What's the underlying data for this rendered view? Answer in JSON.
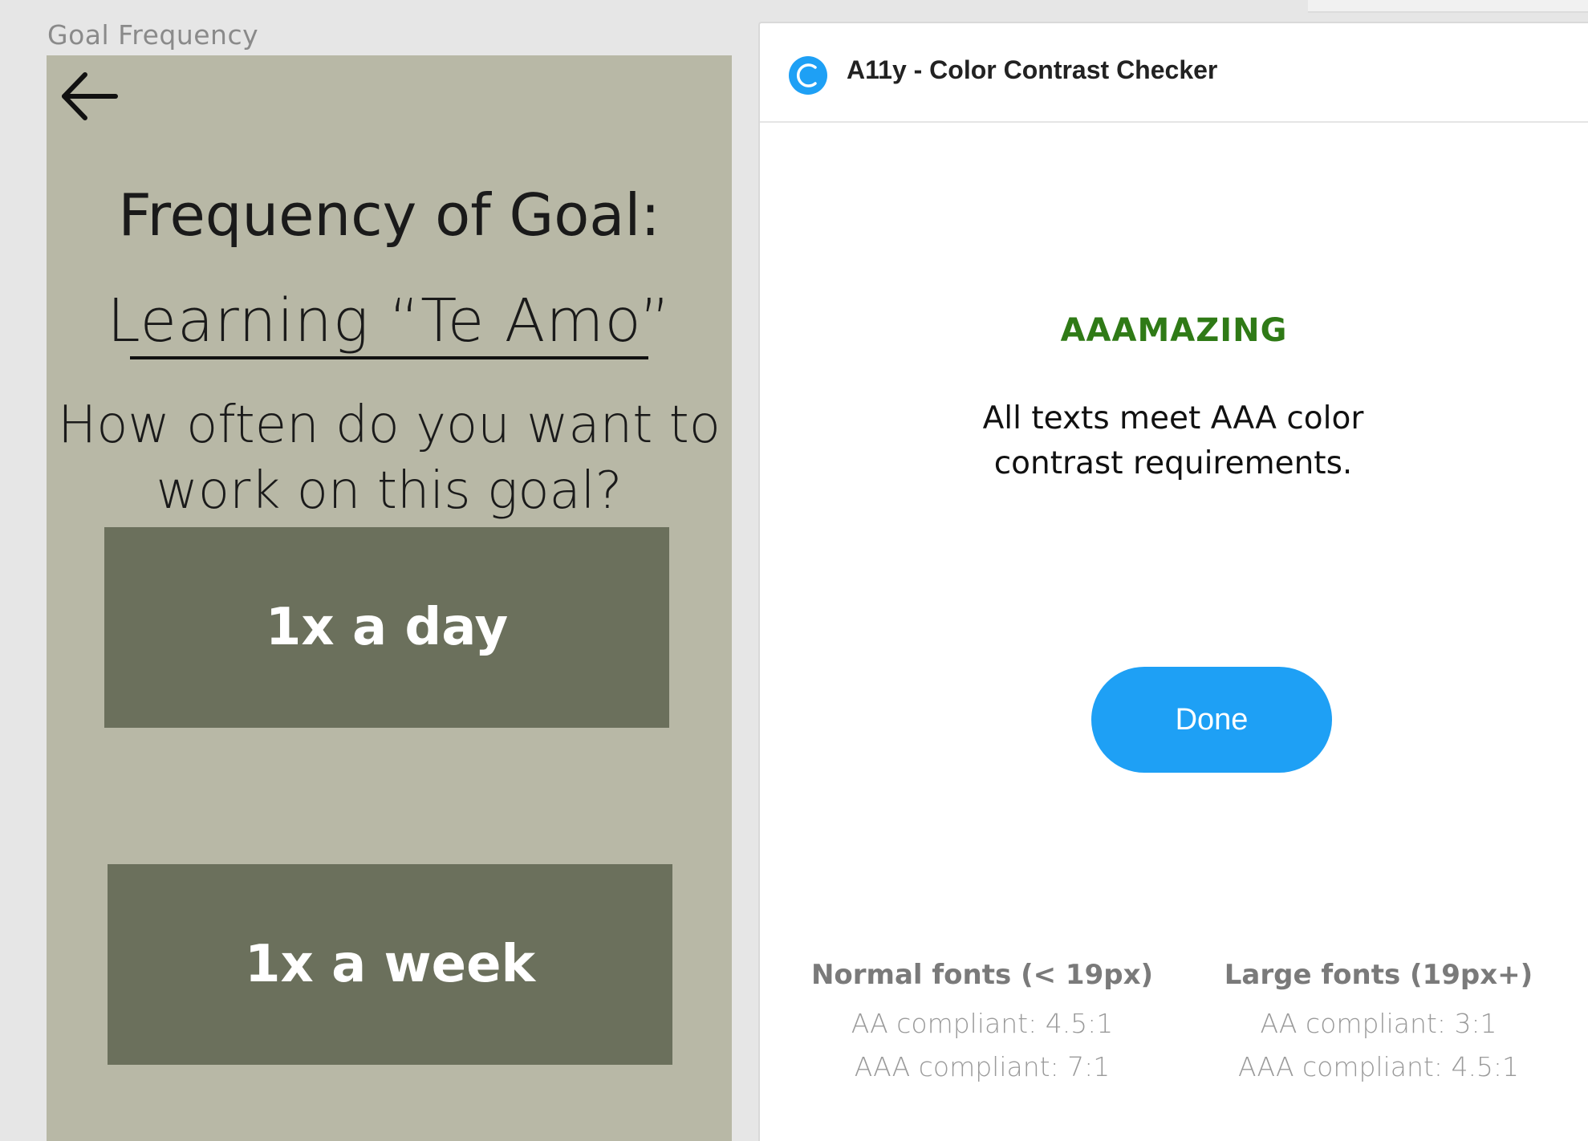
{
  "canvas": {
    "frame_label": "Goal Frequency"
  },
  "phone": {
    "title": "Frequency of Goal:",
    "goal_name": "Learning “Te Amo”",
    "question": "How often do you want to work on this goal?",
    "options": [
      {
        "label": "1x a day"
      },
      {
        "label": "1x a week"
      }
    ],
    "colors": {
      "background": "#b8b8a6",
      "button": "#6b705c",
      "button_text": "#ffffff"
    }
  },
  "plugin": {
    "title": "A11y - Color Contrast Checker",
    "icon": "c-circle-icon",
    "result_heading": "AAAMAZING",
    "result_message": "All texts meet AAA color contrast requirements.",
    "done_label": "Done",
    "legend": {
      "normal": {
        "title": "Normal fonts (< 19px)",
        "aa": "AA compliant: 4.5:1",
        "aaa": "AAA compliant: 7:1"
      },
      "large": {
        "title": "Large fonts (19px+)",
        "aa": "AA compliant: 3:1",
        "aaa": "AAA compliant: 4.5:1"
      }
    },
    "colors": {
      "accent": "#1ea0f5",
      "success": "#2f7a16"
    }
  }
}
